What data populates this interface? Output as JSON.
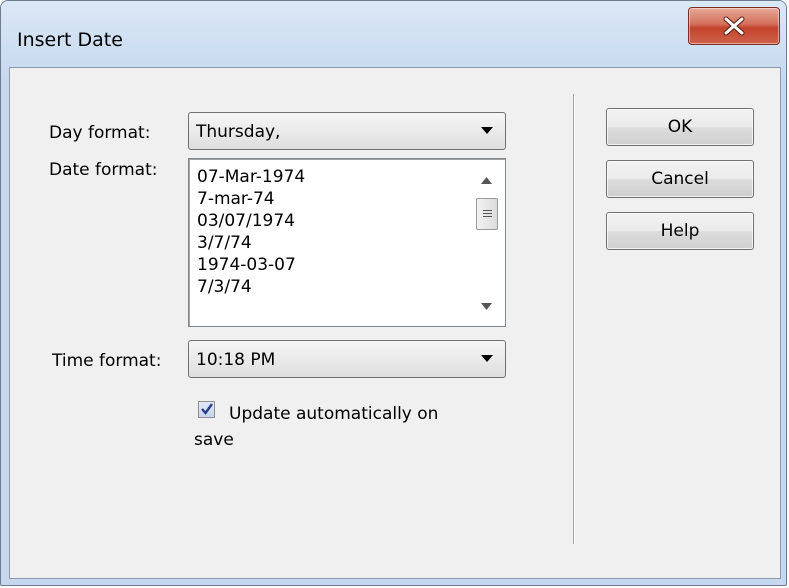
{
  "window": {
    "title": "Insert Date"
  },
  "day_format": {
    "label": "Day format:",
    "value": "Thursday,"
  },
  "date_format": {
    "label": "Date format:",
    "options": [
      "07-Mar-1974",
      "7-mar-74",
      "03/07/1974",
      "3/7/74",
      "1974-03-07",
      "7/3/74"
    ]
  },
  "time_format": {
    "label": "Time format:",
    "value": "10:18 PM"
  },
  "update_option": {
    "line1": "Update automatically on",
    "line2": "save",
    "checked": true
  },
  "buttons": {
    "ok": "OK",
    "cancel": "Cancel",
    "help": "Help"
  },
  "icons": {
    "close": "close-icon",
    "dropdown": "chevron-down-icon",
    "check": "checkmark-icon"
  },
  "colors": {
    "close_button": "#c2432b",
    "frame": "#c5d8ee",
    "client": "#f0f0f0"
  }
}
